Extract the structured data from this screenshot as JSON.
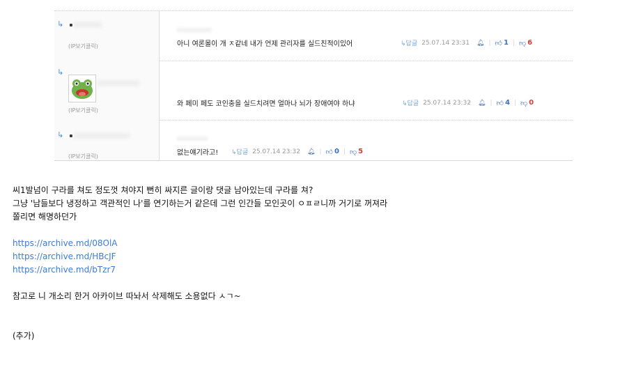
{
  "comments": [
    {
      "ip_view": "(IP보기클릭)",
      "text": "아니 여론몰이 개 ㅈ같네 내가 언제 관리자를 실드친적이있어",
      "reply_label": "↳답글",
      "date": "25.07.14 23:31",
      "upvotes": "1",
      "downvotes": "6"
    },
    {
      "ip_view": "(IP보기클릭)",
      "text": "와 페미 페도 코인충을 실드치려면 얼마나 뇌가 장애여야 하냐",
      "reply_label": "↳답글",
      "date": "25.07.14 23:32",
      "upvotes": "4",
      "downvotes": "0"
    },
    {
      "ip_view": "(IP보기클릭)",
      "text": "없는얘기라고!",
      "reply_label": "↳답글",
      "date": "25.07.14 23:32",
      "upvotes": "0",
      "downvotes": "5"
    }
  ],
  "post": {
    "line1": "씨1발넘이 구라를 쳐도 정도껏 쳐야지 뻔히 싸지른 글이랑 댓글 남아있는데 구라를 쳐?",
    "line2": "그냥 '남들보다 냉정하고 객관적인 나'를 연기하는거 같은데 그런 인간들 모인곳이 ㅇㅍㄹ니까 거기로 꺼져라",
    "line3": "쫄리면 해명하던가",
    "links": [
      "https://archive.md/08OlA",
      "https://archive.md/HBcJF",
      "https://archive.md/bTzr7"
    ],
    "line4": "참고로 니 개소리 한거 아카이브 따놔서 삭제해도 소용없다 ㅅㄱ~",
    "line5": "(추가)"
  },
  "colors": {
    "link": "#3a7bd5",
    "upvote": "#3c6fbf",
    "downvote": "#d43b3b",
    "meta": "#999999"
  },
  "icons": {
    "reply_arrow": "reply-arrow-icon",
    "report": "report-bell-icon",
    "thumb_up": "thumb-up-icon",
    "thumb_down": "thumb-down-icon",
    "avatar": "frog-avatar"
  }
}
